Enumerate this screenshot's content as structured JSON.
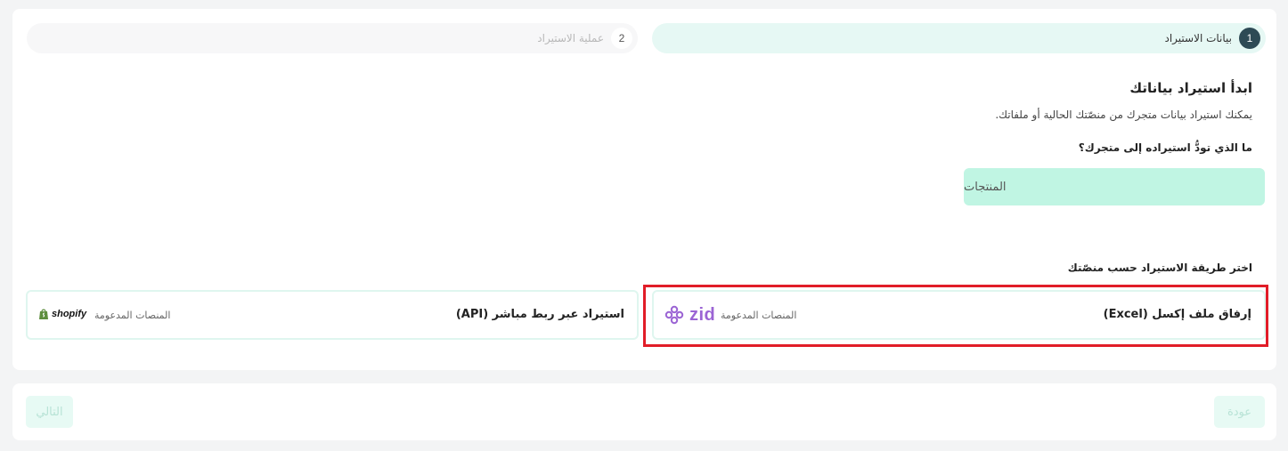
{
  "stepper": {
    "steps": [
      {
        "number": "1",
        "label": "بيانات الاستيراد"
      },
      {
        "number": "2",
        "label": "عملية الاستيراد"
      }
    ]
  },
  "main": {
    "title": "ابدأ استيراد بياناتك",
    "subtitle": "يمكنك استيراد بيانات متجرك من منصّتك الحالية أو ملفاتك.",
    "question": "ما الذي تودُّ استيراده إلى متجرك؟",
    "option_products": "المنتجات",
    "method_title": "اختر طريقة الاستيراد حسب منصّتك"
  },
  "methods": [
    {
      "title": "إرفاق ملف إكسل (Excel)",
      "platforms_label": "المنصات المدعومة",
      "logo_text": "zid",
      "logo_icon": "zid-knot-icon"
    },
    {
      "title": "استيراد عبر ربط مباشر (API)",
      "platforms_label": "المنصات المدعومة",
      "logo_text": "shopify",
      "logo_icon": "shopify-bag-icon"
    }
  ],
  "footer": {
    "back_label": "عودة",
    "next_label": "التالي"
  },
  "colors": {
    "accent_light": "#c0f5e3",
    "step_active": "#e6f8f4",
    "step_badge": "#2e4a55",
    "zid_purple": "#9b64d4",
    "highlight_red": "#e11d28"
  }
}
